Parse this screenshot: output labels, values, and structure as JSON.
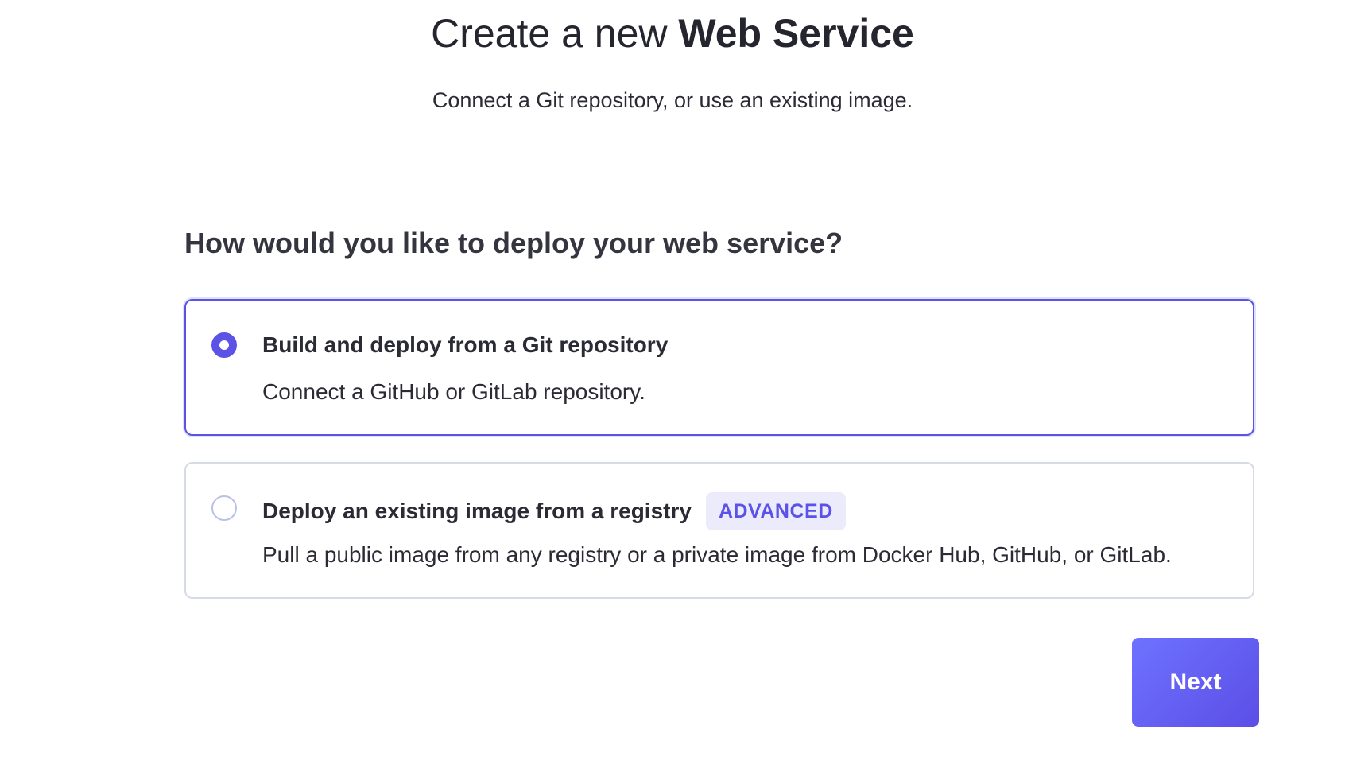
{
  "header": {
    "title_prefix": "Create a new",
    "title_emphasis": "Web Service",
    "subtitle": "Connect a Git repository, or use an existing image."
  },
  "question": "How would you like to deploy your web service?",
  "options": [
    {
      "title": "Build and deploy from a Git repository",
      "description": "Connect a GitHub or GitLab repository.",
      "selected": true
    },
    {
      "title": "Deploy an existing image from a registry",
      "badge": "ADVANCED",
      "description": "Pull a public image from any registry or a private image from Docker Hub, GitHub, or GitLab.",
      "selected": false
    }
  ],
  "actions": {
    "next_label": "Next"
  },
  "colors": {
    "accent": "#5b52e6",
    "badge_bg": "#ecebfc",
    "unselected_border": "#d6dbe6"
  }
}
